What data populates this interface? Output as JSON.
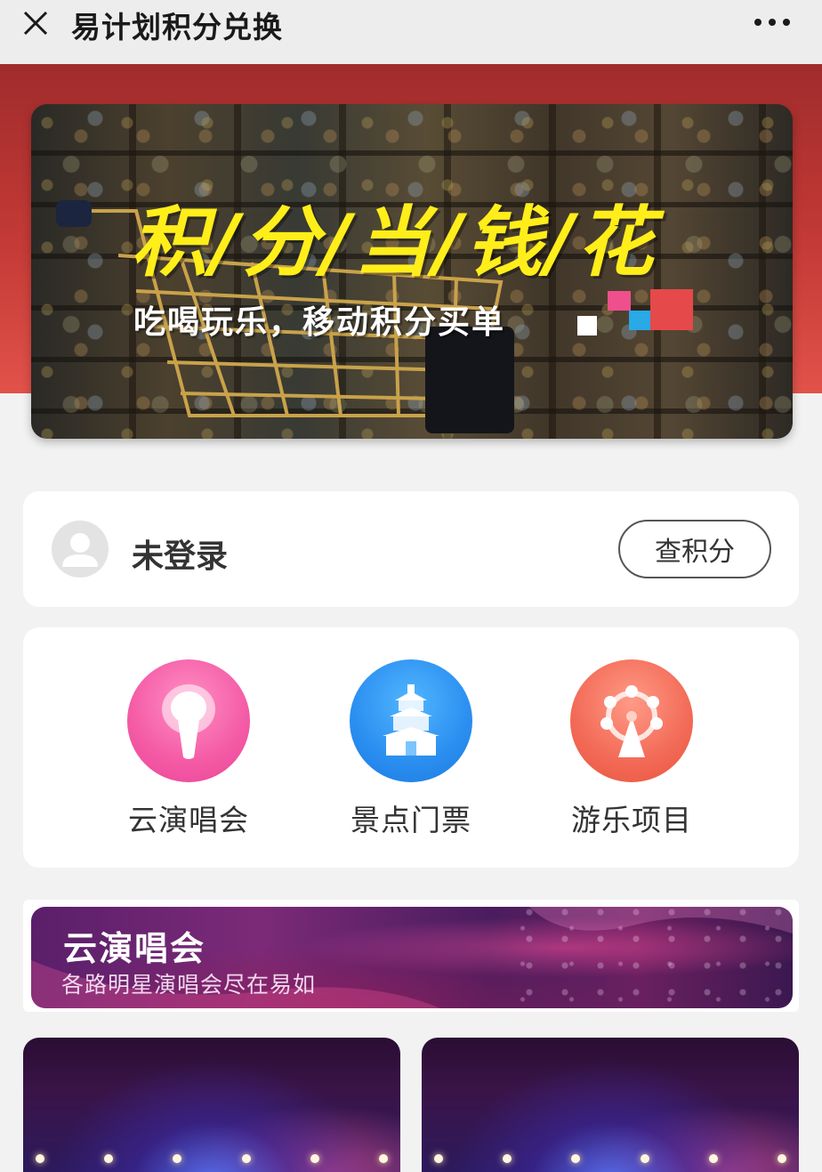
{
  "titlebar": {
    "title": "易计划积分兑换",
    "close_icon": "close-icon",
    "more_icon": "more-icon"
  },
  "banner": {
    "headline": "积/分/当/钱/花",
    "subtitle": "吃喝玩乐，移动积分买单",
    "image": "shopping-cart-supermarket",
    "colors": {
      "headline": "#ffee1a",
      "accent_pink": "#ef4f8c",
      "accent_blue": "#29a9e6",
      "accent_red": "#e5494a"
    }
  },
  "login": {
    "status": "未登录",
    "button_label": "查积分",
    "avatar_icon": "user-avatar-icon"
  },
  "categories": [
    {
      "label": "云演唱会",
      "icon": "microphone-icon",
      "color": "#f45aa5"
    },
    {
      "label": "景点门票",
      "icon": "temple-icon",
      "color": "#2a8ef0"
    },
    {
      "label": "游乐项目",
      "icon": "ferris-wheel-icon",
      "color": "#f26a56"
    }
  ],
  "section": {
    "title": "云演唱会",
    "subtitle": "各路明星演唱会尽在易如"
  },
  "concerts": [
    {
      "image": "concert-stage"
    },
    {
      "image": "concert-stage"
    }
  ]
}
